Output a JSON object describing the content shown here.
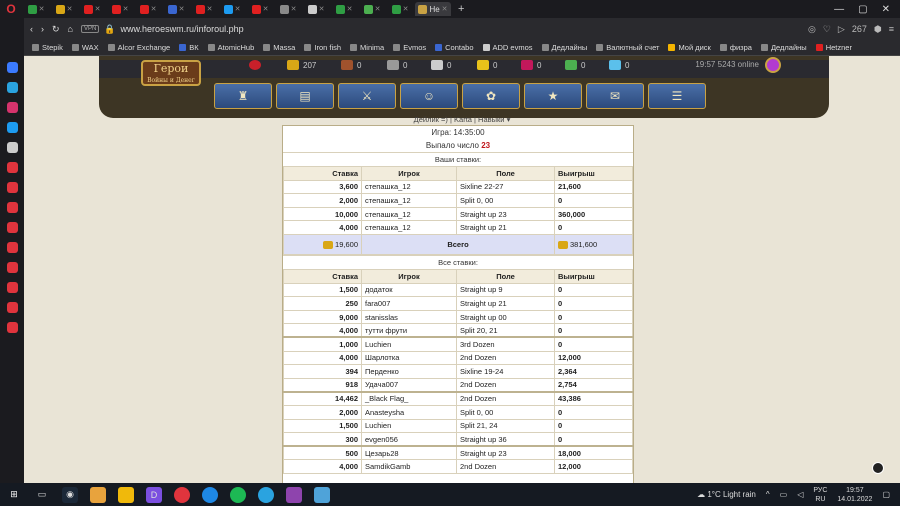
{
  "browser": {
    "url": "www.heroeswm.ru/inforoul.php",
    "vpn": "VPN",
    "tabs": [
      "Не"
    ],
    "badge": "267",
    "bookmarks": [
      "Stepik",
      "WAX",
      "Alcor Exchange",
      "ВК",
      "AtomicHub",
      "Massa",
      "Iron fish",
      "Minima",
      "Evmos",
      "Contabo",
      "ADD evmos",
      "Дедлайны",
      "Валютный счет",
      "Мой диск",
      "физра",
      "Дедлайны",
      "Hetzner"
    ]
  },
  "game": {
    "logo": "Герои",
    "logo_sub": "Войны и Денег",
    "resources": {
      "gold": "207",
      "wood": "0",
      "ore": "0",
      "mercury": "0",
      "sulfur": "0",
      "crystal": "0",
      "gems": "0",
      "diamonds": "0"
    },
    "time": "19:57",
    "online": "5243 online",
    "subnav": "Дейлик =) | Karta | Навыки ▾"
  },
  "roulette": {
    "game_label": "Игра: 14:35:00",
    "result_label": "Выпало число",
    "result_value": "23",
    "your_bets_title": "Ваши ставки:",
    "all_bets_title": "Все ставки:",
    "headers": [
      "Ставка",
      "Игрок",
      "Поле",
      "Выигрыш"
    ],
    "your_bets": [
      [
        "3,600",
        "степашка_12",
        "Sixline 22-27",
        "21,600"
      ],
      [
        "2,000",
        "степашка_12",
        "Split 0, 00",
        "0"
      ],
      [
        "10,000",
        "степашка_12",
        "Straight up 23",
        "360,000"
      ],
      [
        "4,000",
        "степашка_12",
        "Straight up 21",
        "0"
      ]
    ],
    "total": {
      "stake": "19,600",
      "label": "Всего",
      "win": "381,600"
    },
    "all_bets": [
      [
        "1,500",
        "додаток",
        "Straight up 9",
        "0"
      ],
      [
        "250",
        "fara007",
        "Straight up 21",
        "0"
      ],
      [
        "9,000",
        "stanisslas",
        "Straight up 00",
        "0"
      ],
      [
        "4,000",
        "тутти фрути",
        "Split 20, 21",
        "0"
      ],
      [
        "1,000",
        "Luchien",
        "3rd Dozen",
        "0"
      ],
      [
        "4,000",
        "Шарлотка",
        "2nd Dozen",
        "12,000"
      ],
      [
        "394",
        "Перденко",
        "Sixline 19-24",
        "2,364"
      ],
      [
        "918",
        "Удача007",
        "2nd Dozen",
        "2,754"
      ],
      [
        "14,462",
        "_Black Flag_",
        "2nd Dozen",
        "43,386"
      ],
      [
        "2,000",
        "Anasteysha",
        "Split 0, 00",
        "0"
      ],
      [
        "1,500",
        "Luchien",
        "Split 21, 24",
        "0"
      ],
      [
        "300",
        "evgen056",
        "Straight up 36",
        "0"
      ],
      [
        "500",
        "Цезарь28",
        "Straight up 23",
        "18,000"
      ],
      [
        "4,000",
        "SamdikGamb",
        "2nd Dozen",
        "12,000"
      ]
    ]
  },
  "taskbar": {
    "weather": "1°C  Light rain",
    "lang": "РУС",
    "lang2": "RU",
    "time": "19:57",
    "date": "14.01.2022"
  }
}
